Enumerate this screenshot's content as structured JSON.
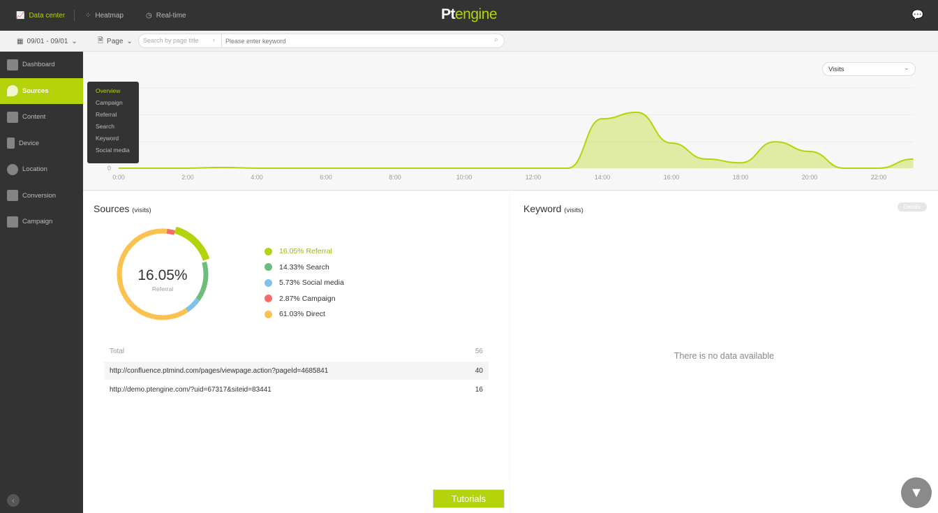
{
  "topnav": {
    "items": [
      {
        "label": "Data center",
        "icon": "line-chart-icon"
      },
      {
        "label": "Heatmap",
        "icon": "heatmap-icon"
      },
      {
        "label": "Real-time",
        "icon": "clock-icon"
      }
    ],
    "logo": {
      "pt": "Pt",
      "engine": "engine"
    }
  },
  "toolbar": {
    "date_range": "09/01 - 09/01",
    "page_select": "Page",
    "search_scope_placeholder": "Search by page title",
    "keyword_placeholder": "Please enter keyword"
  },
  "sidebar": {
    "items": [
      {
        "label": "Dashboard"
      },
      {
        "label": "Sources"
      },
      {
        "label": "Content"
      },
      {
        "label": "Device"
      },
      {
        "label": "Location"
      },
      {
        "label": "Conversion"
      },
      {
        "label": "Campaign"
      }
    ]
  },
  "flyout": {
    "items": [
      "Overview",
      "Campaign",
      "Referral",
      "Search",
      "Keyword",
      "Social media"
    ]
  },
  "metric_select": "Visits",
  "chart_data": {
    "type": "area",
    "y_tick_labels": [
      "0"
    ],
    "x_tick_labels": [
      "0:00",
      "2:00",
      "4:00",
      "6:00",
      "8:00",
      "10:00",
      "12:00",
      "14:00",
      "16:00",
      "18:00",
      "20:00",
      "22:00"
    ],
    "x": [
      "0:00",
      "1:00",
      "2:00",
      "3:00",
      "4:00",
      "5:00",
      "6:00",
      "7:00",
      "8:00",
      "9:00",
      "10:00",
      "11:00",
      "12:00",
      "13:00",
      "14:00",
      "15:00",
      "16:00",
      "17:00",
      "18:00",
      "19:00",
      "20:00",
      "21:00",
      "22:00",
      "23:00"
    ],
    "values": [
      0,
      0,
      0,
      0.03,
      0,
      0,
      0,
      0,
      0,
      0,
      0,
      0,
      0,
      0,
      1.83,
      2.07,
      0.93,
      0.34,
      0.2,
      0.98,
      0.62,
      0,
      0,
      0.34
    ],
    "grid": true,
    "color": "#b5d30a"
  },
  "sources": {
    "title": "Sources",
    "unit": "(visits)",
    "center_value": "16.05%",
    "center_label": "Referral",
    "legend": [
      {
        "label": "16.05%  Referral",
        "value": 16.05,
        "color": "#b5d30a"
      },
      {
        "label": "14.33%  Search",
        "value": 14.33,
        "color": "#6dbd7d"
      },
      {
        "label": "5.73%  Social media",
        "value": 5.73,
        "color": "#83c1e8"
      },
      {
        "label": "2.87%  Campaign",
        "value": 2.87,
        "color": "#f96b6b"
      },
      {
        "label": "61.03%  Direct",
        "value": 61.03,
        "color": "#fbc24f"
      }
    ],
    "table": {
      "total_label": "Total",
      "total_value": "56",
      "rows": [
        {
          "url": "http://confluence.ptmind.com/pages/viewpage.action?pageId=4685841",
          "value": "40"
        },
        {
          "url": "http://demo.ptengine.com/?uid=67317&siteid=83441",
          "value": "16"
        }
      ]
    }
  },
  "keyword": {
    "title": "Keyword",
    "unit": "(visits)",
    "details": "Details",
    "empty": "There is no data available"
  },
  "tutorials": "Tutorials"
}
